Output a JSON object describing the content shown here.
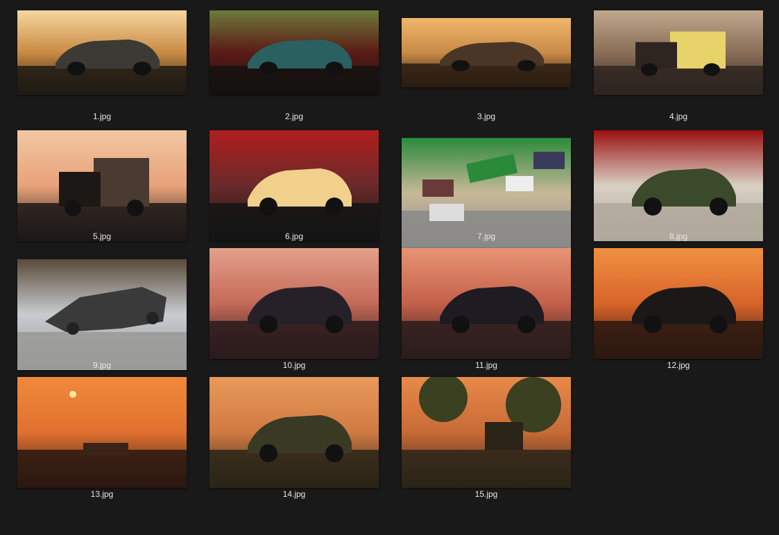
{
  "files": [
    {
      "name": "1.jpg",
      "palette": [
        "#1e1a14",
        "#c98a42",
        "#f5d7a0",
        "#3b3a34"
      ],
      "subject": "hatchback-icon"
    },
    {
      "name": "2.jpg",
      "palette": [
        "#141210",
        "#5b1a16",
        "#6c7a3a",
        "#2a6060"
      ],
      "subject": "hatchback-icon"
    },
    {
      "name": "3.jpg",
      "palette": [
        "#2a1c10",
        "#c98a48",
        "#f0b66a",
        "#4a3626"
      ],
      "subject": "sedan-icon"
    },
    {
      "name": "4.jpg",
      "palette": [
        "#2e2520",
        "#8a6e58",
        "#c0a88c",
        "#e8d36a"
      ],
      "subject": "truck-icon"
    },
    {
      "name": "5.jpg",
      "palette": [
        "#1c1816",
        "#e8a27a",
        "#f2c8a2",
        "#4a3a30"
      ],
      "subject": "truck-icon"
    },
    {
      "name": "6.jpg",
      "palette": [
        "#141414",
        "#6a2a2a",
        "#b01e1e",
        "#f0d08a"
      ],
      "subject": "sports-car-icon"
    },
    {
      "name": "7.jpg",
      "palette": [
        "#8a8a88",
        "#c8b898",
        "#2a8a3a",
        "#3a3a5a"
      ],
      "subject": "traffic-icon"
    },
    {
      "name": "8.jpg",
      "palette": [
        "#b0a89c",
        "#d8d0c4",
        "#9a1010",
        "#3a4a2a"
      ],
      "subject": "roadster-icon"
    },
    {
      "name": "9.jpg",
      "palette": [
        "#9a9a98",
        "#c8ccd0",
        "#5a4a38",
        "#3a3a3a"
      ],
      "subject": "wreck-icon"
    },
    {
      "name": "10.jpg",
      "palette": [
        "#2a1a1c",
        "#c46a58",
        "#e4a08a",
        "#262028"
      ],
      "subject": "sedan-icon"
    },
    {
      "name": "11.jpg",
      "palette": [
        "#2a1c1c",
        "#c4604a",
        "#e89474",
        "#1e1c22"
      ],
      "subject": "sedan-icon"
    },
    {
      "name": "12.jpg",
      "palette": [
        "#2a1810",
        "#d8642a",
        "#f09040",
        "#1c1818"
      ],
      "subject": "sedan-icon"
    },
    {
      "name": "13.jpg",
      "palette": [
        "#2a1810",
        "#e07030",
        "#f08a3a",
        "#3a2418"
      ],
      "subject": "sunset-icon"
    },
    {
      "name": "14.jpg",
      "palette": [
        "#2a2418",
        "#d07a42",
        "#e89a5a",
        "#3a3a24"
      ],
      "subject": "sedan-icon"
    },
    {
      "name": "15.jpg",
      "palette": [
        "#2a2418",
        "#c86a36",
        "#e88a4a",
        "#3a4020"
      ],
      "subject": "forest-icon"
    }
  ]
}
